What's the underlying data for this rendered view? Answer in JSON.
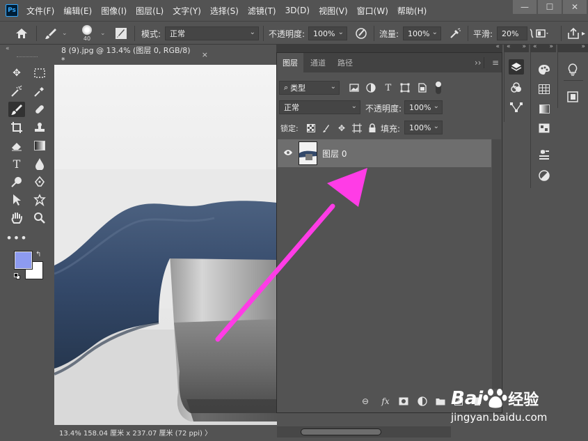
{
  "app": {
    "logo": "Ps"
  },
  "menu": [
    "文件(F)",
    "编辑(E)",
    "图像(I)",
    "图层(L)",
    "文字(Y)",
    "选择(S)",
    "滤镜(T)",
    "3D(D)",
    "视图(V)",
    "窗口(W)",
    "帮助(H)"
  ],
  "window_controls": {
    "minimize": "—",
    "restore": "☐",
    "close": "✕"
  },
  "options": {
    "brush_size": "40",
    "mode_label": "模式:",
    "mode_value": "正常",
    "opacity_label": "不透明度:",
    "opacity_value": "100%",
    "flow_label": "流量:",
    "flow_value": "100%",
    "smoothing_label": "平滑:",
    "smoothing_value": "20%"
  },
  "document": {
    "tab_title": "8 (9).jpg @ 13.4% (图层 0, RGB/8) *",
    "close": "×",
    "status": "13.4%   158.04 厘米 x 237.07 厘米 (72 ppi)  〉"
  },
  "colors": {
    "foreground": "#8d9bf0",
    "background": "#ffffff",
    "arrow": "#ff3ce6",
    "panel_bg": "#535353"
  },
  "layers_panel": {
    "tabs": [
      "图层",
      "通道",
      "路径"
    ],
    "filter_label": "类型",
    "blend_mode": "正常",
    "opacity_label": "不透明度:",
    "opacity_value": "100%",
    "lock_label": "锁定:",
    "fill_label": "填充:",
    "fill_value": "100%",
    "layers": [
      {
        "name": "图层 0",
        "visible": true
      }
    ],
    "bottom_fx": "fx"
  },
  "watermark": {
    "brand": "Bai",
    "brand2": "经验",
    "url": "jingyan.baidu.com"
  }
}
